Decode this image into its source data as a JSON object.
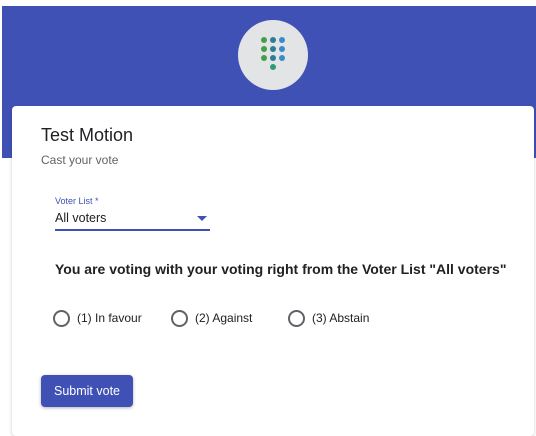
{
  "header": {
    "logo_icon": "dot-grid-logo-icon",
    "brand_color": "#3f51b5"
  },
  "form": {
    "title": "Test Motion",
    "subtitle": "Cast your vote",
    "voter_list": {
      "label": "Voter List *",
      "value": "All voters"
    },
    "question": "You are voting with your voting right from the Voter List \"All voters\"",
    "options": [
      {
        "label": "(1) In favour",
        "selected": false
      },
      {
        "label": "(2) Against",
        "selected": false
      },
      {
        "label": "(3) Abstain",
        "selected": false
      }
    ],
    "submit_label": "Submit vote"
  }
}
